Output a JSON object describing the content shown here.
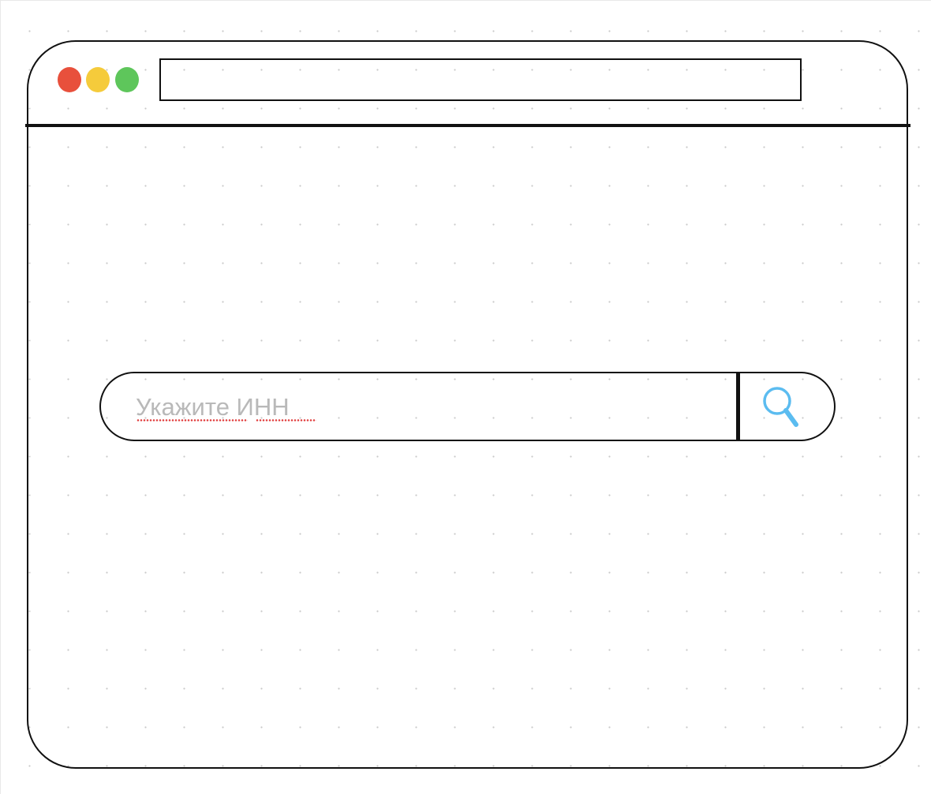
{
  "window": {
    "traffic_lights": {
      "close_color": "#e8503c",
      "minimize_color": "#f5cb3b",
      "maximize_color": "#5ec65b"
    },
    "address_bar": {
      "value": ""
    }
  },
  "search": {
    "placeholder": "Укажите ИНН",
    "value": "",
    "button_icon": "search-icon",
    "icon_color": "#5bbcf0"
  }
}
